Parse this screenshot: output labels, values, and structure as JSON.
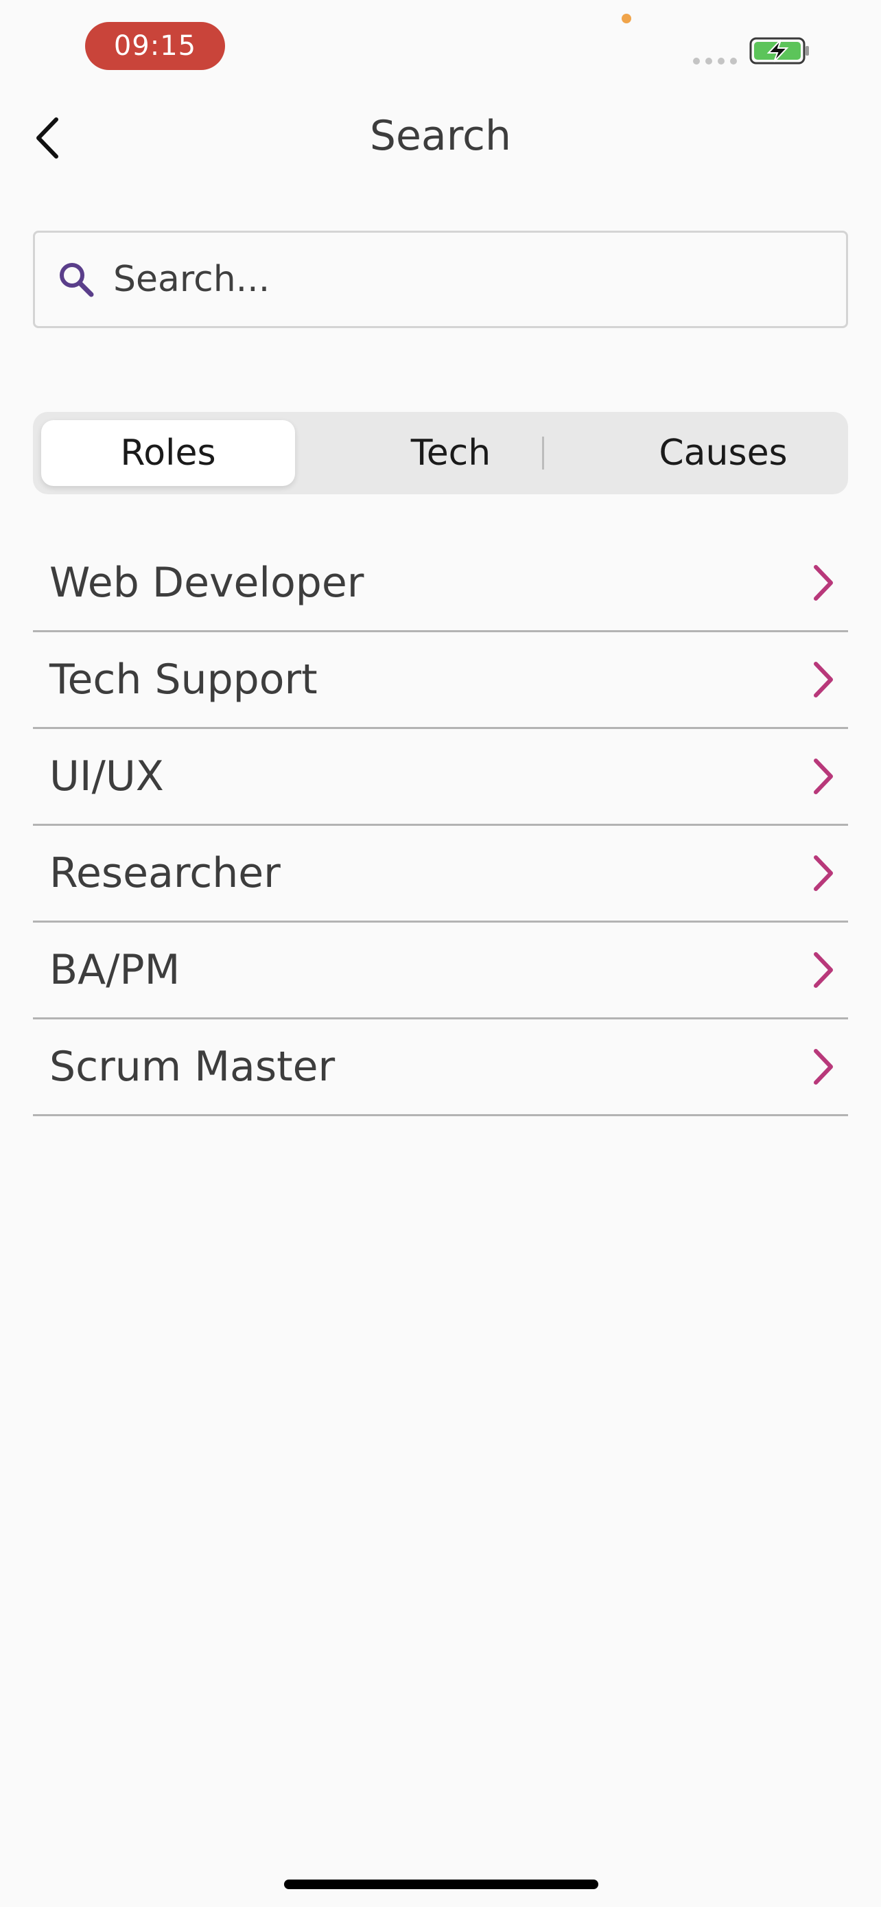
{
  "status_bar": {
    "time": "09:15",
    "time_badge_color": "#c9443a",
    "battery_icon": "battery-charging-icon",
    "battery_color": "#5cc45a"
  },
  "nav": {
    "title": "Search",
    "back_icon": "chevron-left-icon"
  },
  "search": {
    "icon": "search-icon",
    "icon_color": "#5a3e8a",
    "placeholder": "Search...",
    "value": ""
  },
  "tabs": {
    "items": [
      {
        "label": "Roles",
        "selected": true
      },
      {
        "label": "Tech",
        "selected": false
      },
      {
        "label": "Causes",
        "selected": false
      }
    ]
  },
  "roles": {
    "chevron_icon": "chevron-right-icon",
    "chevron_color": "#b8387a",
    "items": [
      {
        "label": "Web Developer"
      },
      {
        "label": "Tech Support"
      },
      {
        "label": "UI/UX"
      },
      {
        "label": "Researcher"
      },
      {
        "label": "BA/PM"
      },
      {
        "label": "Scrum Master"
      }
    ]
  }
}
